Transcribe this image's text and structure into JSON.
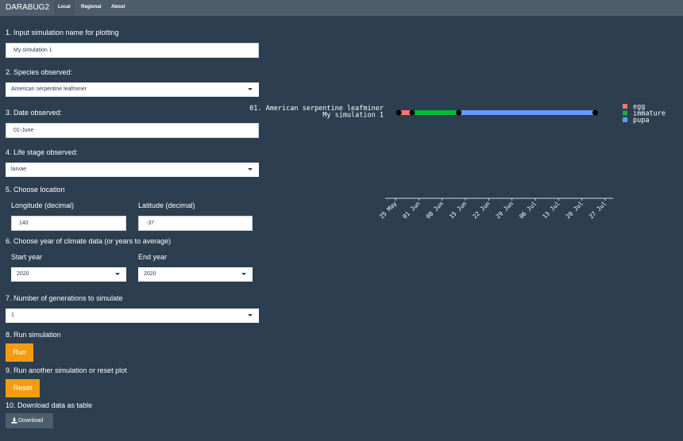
{
  "navbar": {
    "brand": "DARABUG2",
    "tabs": [
      {
        "label": "Local",
        "active": true
      },
      {
        "label": "Regional",
        "active": false
      },
      {
        "label": "About",
        "active": false
      }
    ]
  },
  "form": {
    "sim_name": {
      "label": "1. Input simulation name for plotting",
      "value": "My simulation 1"
    },
    "species": {
      "label": "2. Species observed:",
      "value": "American serpentine leafminer"
    },
    "date": {
      "label": "3. Date observed:",
      "value": "01-June"
    },
    "stage": {
      "label": "4. Life stage observed:",
      "value": "larvae"
    },
    "location": {
      "label": "5. Choose location",
      "lon_label": "Longitude (decimal)",
      "lon_value": "140",
      "lat_label": "Latitude (decimal)",
      "lat_value": "-37"
    },
    "years": {
      "label": "6. Choose year of climate data (or years to average)",
      "start_label": "Start year",
      "start_value": "2020",
      "end_label": "End year",
      "end_value": "2020"
    },
    "generations": {
      "label": "7. Number of generations to simulate",
      "value": "1"
    },
    "run": {
      "label": "8. Run simulation",
      "button": "Run"
    },
    "reset": {
      "label": "9. Run another simulation or reset plot",
      "button": "Reset"
    },
    "download": {
      "label": "10. Download data as table",
      "button": "Download"
    }
  },
  "colors": {
    "background": "#2c3e50",
    "navbar": "#4e5d6c",
    "accent": "#f39c12",
    "egg": "#f8766d",
    "immature": "#00ba38",
    "pupa": "#619cff"
  },
  "chart_data": {
    "type": "timeline",
    "row_labels": [
      "01. American serpentine leafminer",
      "My simulation 1"
    ],
    "x_tick_labels": [
      "25 May",
      "01 Jun",
      "08 Jun",
      "15 Jun",
      "22 Jun",
      "29 Jun",
      "06 Jul",
      "13 Jul",
      "20 Jul",
      "27 Jul"
    ],
    "x_range": [
      "2020-05-25",
      "2020-07-27"
    ],
    "segments": [
      {
        "stage": "egg",
        "start": "2020-05-26",
        "end": "2020-05-30"
      },
      {
        "stage": "immature",
        "start": "2020-05-30",
        "end": "2020-06-13"
      },
      {
        "stage": "pupa",
        "start": "2020-06-13",
        "end": "2020-07-24"
      }
    ],
    "legend": [
      "egg",
      "immature",
      "pupa"
    ],
    "legend_position": "right"
  }
}
